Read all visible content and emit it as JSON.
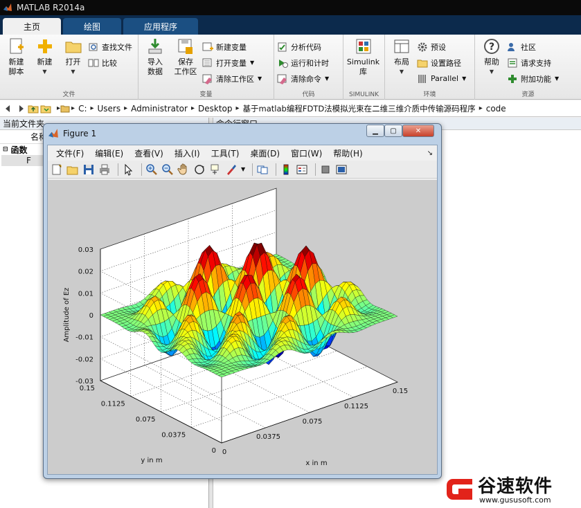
{
  "app": {
    "title": "MATLAB R2014a"
  },
  "ribbon_tabs": [
    {
      "label": "主页",
      "active": true
    },
    {
      "label": "绘图",
      "active": false
    },
    {
      "label": "应用程序",
      "active": false
    }
  ],
  "ribbon": {
    "file_group": {
      "label": "文件",
      "new_script": "新建\n脚本",
      "new": "新建",
      "open": "打开",
      "find_files": "查找文件",
      "compare": "比较"
    },
    "variable_group": {
      "label": "变量",
      "import_data": "导入\n数据",
      "save_workspace": "保存\n工作区",
      "new_variable": "新建变量",
      "open_variable": "打开变量",
      "clear_workspace": "清除工作区"
    },
    "code_group": {
      "label": "代码",
      "analyze_code": "分析代码",
      "run_and_time": "运行和计时",
      "clear_commands": "清除命令"
    },
    "simulink_group": {
      "label": "SIMULINK",
      "library": "Simulink\n库"
    },
    "environment_group": {
      "label": "环境",
      "layout": "布局",
      "preferences": "预设",
      "set_path": "设置路径",
      "parallel": "Parallel"
    },
    "resources_group": {
      "label": "资源",
      "help": "帮助",
      "community": "社区",
      "request_support": "请求支持",
      "addons": "附加功能"
    }
  },
  "address": {
    "crumbs": [
      "C:",
      "Users",
      "Administrator",
      "Desktop",
      "基于matlab编程FDTD法模拟光束在二维三维介质中传输源码程序",
      "code"
    ]
  },
  "left_panel": {
    "title": "当前文件夹",
    "column_name": "名称",
    "group": "函数",
    "item": "F"
  },
  "right_panel": {
    "title": "命令行窗口"
  },
  "figure": {
    "title": "Figure 1",
    "menu": [
      "文件(F)",
      "编辑(E)",
      "查看(V)",
      "插入(I)",
      "工具(T)",
      "桌面(D)",
      "窗口(W)",
      "帮助(H)"
    ]
  },
  "chart_data": {
    "type": "surface",
    "title": "",
    "xlabel": "x in m",
    "ylabel": "y in m",
    "zlabel": "Amplitude of Ez",
    "xlim": [
      0,
      0.15
    ],
    "ylim": [
      0,
      0.15
    ],
    "zlim": [
      -0.03,
      0.03
    ],
    "x_ticks": [
      "0",
      "0.0375",
      "0.075",
      "0.1125",
      "0.15"
    ],
    "y_ticks": [
      "0",
      "0.0375",
      "0.075",
      "0.1125",
      "0.15"
    ],
    "z_ticks": [
      "-0.03",
      "-0.02",
      "-0.01",
      "0",
      "0.01",
      "0.02",
      "0.03"
    ],
    "colormap": "jet",
    "grid": true
  },
  "watermark": {
    "text": "谷速软件",
    "url": "www.gususoft.com"
  }
}
